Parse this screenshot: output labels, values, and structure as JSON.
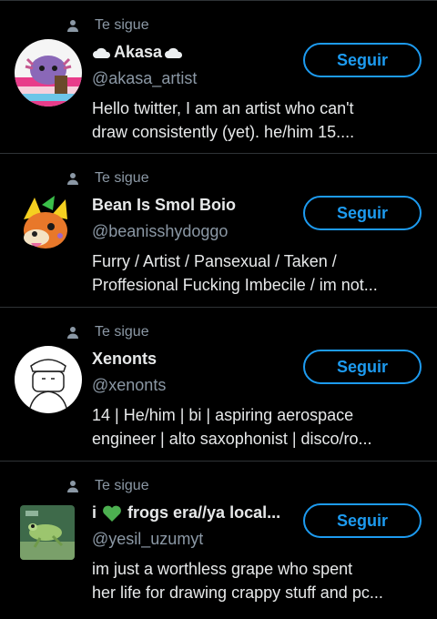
{
  "accent_color": "#1d9bf0",
  "follows_label": "Te sigue",
  "users": [
    {
      "name": "Akasa",
      "name_decoration": "cloud-icon",
      "handle": "@akasa_artist",
      "bio_line1": "Hello twitter, I am an artist who can't",
      "bio_line2": "draw consistently (yet). he/him 15....",
      "button": "Seguir"
    },
    {
      "name": "Bean Is Smol Boio",
      "handle": "@beanisshydoggo",
      "bio_line1": "Furry / Artist / Pansexual / Taken /",
      "bio_line2": "Proffesional Fucking Imbecile / im not...",
      "button": "Seguir"
    },
    {
      "name": "Xenonts",
      "handle": "@xenonts",
      "bio_line1": "14 | He/him | bi | aspiring aerospace",
      "bio_line2": "engineer | alto saxophonist | disco/ro...",
      "button": "Seguir"
    },
    {
      "name_prefix": "i",
      "name_decoration": "green-heart-icon",
      "name": "frogs era//ya local...",
      "handle": "@yesil_uzumyt",
      "bio_line1": "im just a worthless grape who spent",
      "bio_line2": "her life for drawing crappy stuff and pc...",
      "button": "Seguir"
    }
  ]
}
